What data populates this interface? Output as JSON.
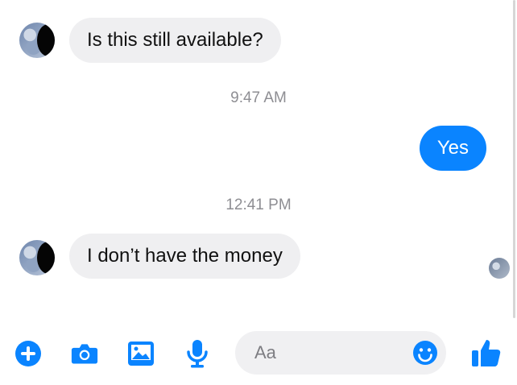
{
  "messages": [
    {
      "sender": "other",
      "text": "Is this still available?"
    },
    {
      "sender": "me",
      "text": "Yes"
    },
    {
      "sender": "other",
      "text": "I don’t have the money"
    }
  ],
  "timestamps": [
    "9:47 AM",
    "12:41 PM"
  ],
  "composer": {
    "placeholder": "Aa",
    "tools": [
      "plus-icon",
      "camera-icon",
      "gallery-icon",
      "microphone-icon",
      "emoji-icon",
      "like-icon"
    ]
  },
  "colors": {
    "accent": "#0a84ff",
    "incoming_bubble": "#efeff1",
    "timestamp": "#8e8e93"
  }
}
